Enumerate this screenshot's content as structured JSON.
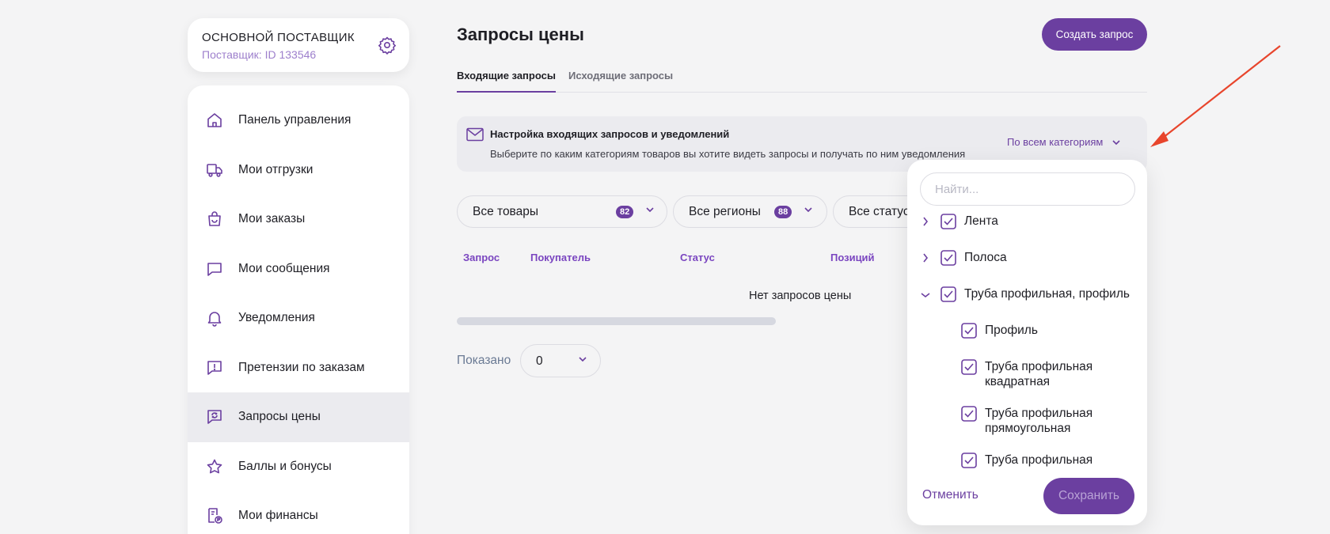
{
  "supplier": {
    "name": "ОСНОВНОЙ ПОСТАВЩИК",
    "id_label": "Поставщик: ID 133546"
  },
  "sidebar": {
    "items": [
      {
        "label": "Панель управления",
        "icon": "home-icon"
      },
      {
        "label": "Мои отгрузки",
        "icon": "truck-icon"
      },
      {
        "label": "Мои заказы",
        "icon": "shopping-bag-icon"
      },
      {
        "label": "Мои сообщения",
        "icon": "message-icon"
      },
      {
        "label": "Уведомления",
        "icon": "bell-icon"
      },
      {
        "label": "Претензии по заказам",
        "icon": "claim-icon"
      },
      {
        "label": "Запросы цены",
        "icon": "price-request-icon",
        "active": true
      },
      {
        "label": "Баллы и бонусы",
        "icon": "star-icon"
      },
      {
        "label": "Мои финансы",
        "icon": "finance-icon"
      }
    ]
  },
  "header": {
    "title": "Запросы цены",
    "create_label": "Создать запрос"
  },
  "tabs": [
    {
      "label": "Входящие запросы",
      "active": true
    },
    {
      "label": "Исходящие запросы",
      "active": false
    }
  ],
  "info": {
    "title": "Настройка входящих запросов и уведомлений",
    "subtitle": "Выберите по каким категориям товаров вы хотите видеть запросы и получать по ним уведомления",
    "category_select": "По всем категориям"
  },
  "filters": {
    "products": {
      "label": "Все товары",
      "count": "82"
    },
    "regions": {
      "label": "Все регионы",
      "count": "88"
    },
    "statuses": {
      "label": "Все статусы"
    }
  },
  "table": {
    "columns": [
      "Запрос",
      "Покупатель",
      "Статус",
      "Позиций"
    ],
    "empty_message": "Нет запросов цены"
  },
  "pagination": {
    "shown_label": "Показано",
    "page_size": "0"
  },
  "dropdown": {
    "search_placeholder": "Найти...",
    "items": [
      {
        "label": "Лента",
        "level": 0,
        "expanded": false,
        "checked": true
      },
      {
        "label": "Полоса",
        "level": 0,
        "expanded": false,
        "checked": true
      },
      {
        "label": "Труба профильная, профиль",
        "level": 0,
        "expanded": true,
        "checked": true
      },
      {
        "label": "Профиль",
        "level": 1,
        "checked": true
      },
      {
        "label": "Труба профильная квадратная",
        "level": 1,
        "checked": true
      },
      {
        "label": "Труба профильная прямоугольная",
        "level": 1,
        "checked": true
      },
      {
        "label": "Труба профильная",
        "level": 1,
        "checked": true
      }
    ],
    "cancel_label": "Отменить",
    "save_label": "Сохранить"
  },
  "colors": {
    "accent": "#6b3fa0",
    "annotation_arrow": "#e8452c"
  }
}
